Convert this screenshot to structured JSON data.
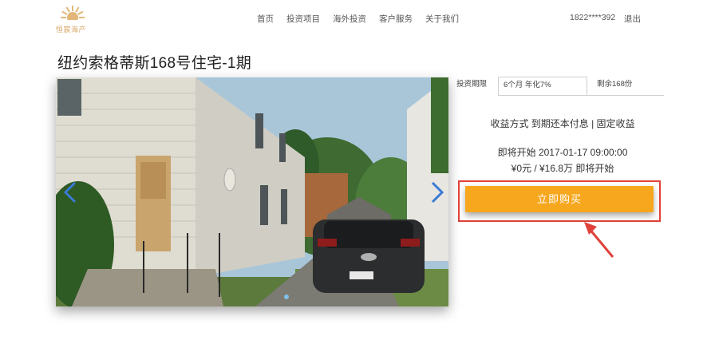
{
  "header": {
    "logo_text": "恒宸海产",
    "nav": [
      {
        "label": "首页"
      },
      {
        "label": "投资项目"
      },
      {
        "label": "海外投资"
      },
      {
        "label": "客户服务"
      },
      {
        "label": "关于我们"
      }
    ],
    "phone": "1822****392",
    "login": "退出"
  },
  "page": {
    "title": "纽约索格蒂斯168号住宅-1期"
  },
  "panel": {
    "tabs": [
      {
        "label": "投资期限"
      },
      {
        "label": "6个月 年化7%"
      },
      {
        "label": "剩余168份"
      }
    ],
    "return_method": "收益方式 到期还本付息 | 固定收益",
    "start_info": "即将开始 2017-01-17 09:00:00",
    "amount_info": "¥0元 / ¥16.8万 即将开始",
    "buy_button": "立即购买"
  },
  "colors": {
    "accent": "#f7a71e",
    "highlight": "#e0413b",
    "logo": "#d7a765",
    "carousel_arrow": "#3a7bd5"
  },
  "carousel": {
    "slide_count": 1,
    "active_index": 0
  }
}
